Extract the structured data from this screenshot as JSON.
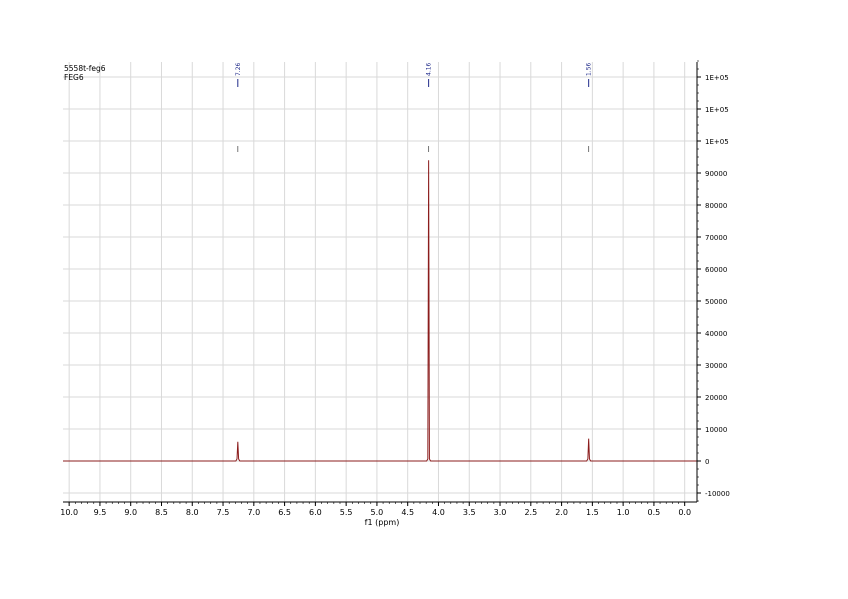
{
  "chart_data": {
    "type": "line",
    "sample_name": "5558t-feg6",
    "sample_code": "FEG6",
    "xlabel": "f1 (ppm)",
    "ylabel": "",
    "xlim": [
      10.1,
      -0.2
    ],
    "ylim": [
      -10000,
      120000
    ],
    "x_ticks": [
      "10.0",
      "9.5",
      "9.0",
      "8.5",
      "8.0",
      "7.5",
      "7.0",
      "6.5",
      "6.0",
      "5.5",
      "5.0",
      "4.5",
      "4.0",
      "3.5",
      "3.0",
      "2.5",
      "2.0",
      "1.5",
      "1.0",
      "0.5",
      "0.0"
    ],
    "y_ticks": [
      {
        "value": 110000,
        "label": "1E+05"
      },
      {
        "value": 100000,
        "label": "1E+05"
      },
      {
        "value": 90000,
        "label": "1E+05"
      },
      {
        "value": 80000,
        "label": "90000"
      },
      {
        "value": 70000,
        "label": "80000"
      },
      {
        "value": 60000,
        "label": "70000"
      },
      {
        "value": 50000,
        "label": "60000"
      },
      {
        "value": 40000,
        "label": "50000"
      },
      {
        "value": 30000,
        "label": "40000"
      },
      {
        "value": 20000,
        "label": "30000"
      },
      {
        "value": 10000,
        "label": "20000"
      },
      {
        "value": 0,
        "label": "10000"
      },
      {
        "value": -10000,
        "label": "0"
      },
      {
        "value": -20000,
        "label": "-10000"
      }
    ],
    "peaks": [
      {
        "ppm": 7.26,
        "label": "7.26",
        "height": 6000
      },
      {
        "ppm": 4.16,
        "label": "4.16",
        "height": 94000
      },
      {
        "ppm": 1.56,
        "label": "1.56",
        "height": 7000
      }
    ],
    "grid": true,
    "colors": {
      "spectrum": "#8b1c1c",
      "grid": "#d9d9d9",
      "peak_label": "#1f2a8a",
      "axis": "#000000"
    }
  }
}
